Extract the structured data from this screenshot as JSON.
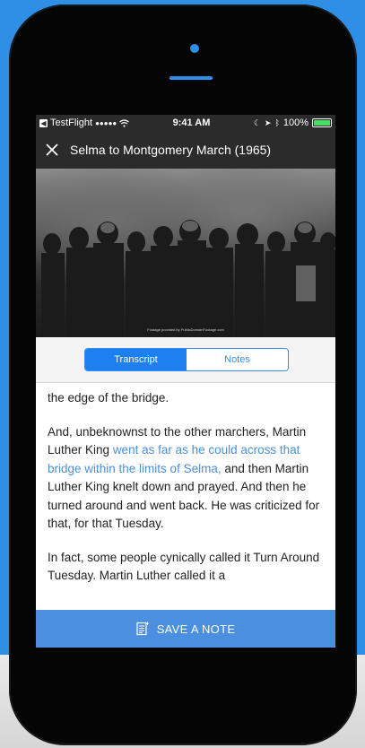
{
  "status_bar": {
    "back_app": "TestFlight",
    "signal": "●●●●●",
    "time": "9:41 AM",
    "battery": "100%",
    "battery_level": 1.0
  },
  "nav": {
    "title": "Selma to Montgomery March (1965)"
  },
  "video": {
    "credit": "Footage provided by PublicDomainFootage.com"
  },
  "tabs": [
    {
      "label": "Transcript",
      "active": true
    },
    {
      "label": "Notes",
      "active": false
    }
  ],
  "transcript": {
    "p1": "the edge of the bridge.",
    "p2_before": "And, unbeknownst to the other marchers, Martin Luther King ",
    "p2_highlight": "went as far as he could across that bridge within the limits of Selma,",
    "p2_after": " and then Martin Luther King knelt down and prayed. And then he turned around and went back. He was criticized for that, for that Tuesday.",
    "p3": "In fact, some people cynically called it Turn Around Tuesday. Martin Luther called it a"
  },
  "save_note": {
    "label": "SAVE A NOTE"
  },
  "colors": {
    "accent": "#1e7ff0",
    "highlight_text": "#4a90d9",
    "save_bar": "#4a8fe0",
    "background": "#2f8fe6"
  }
}
